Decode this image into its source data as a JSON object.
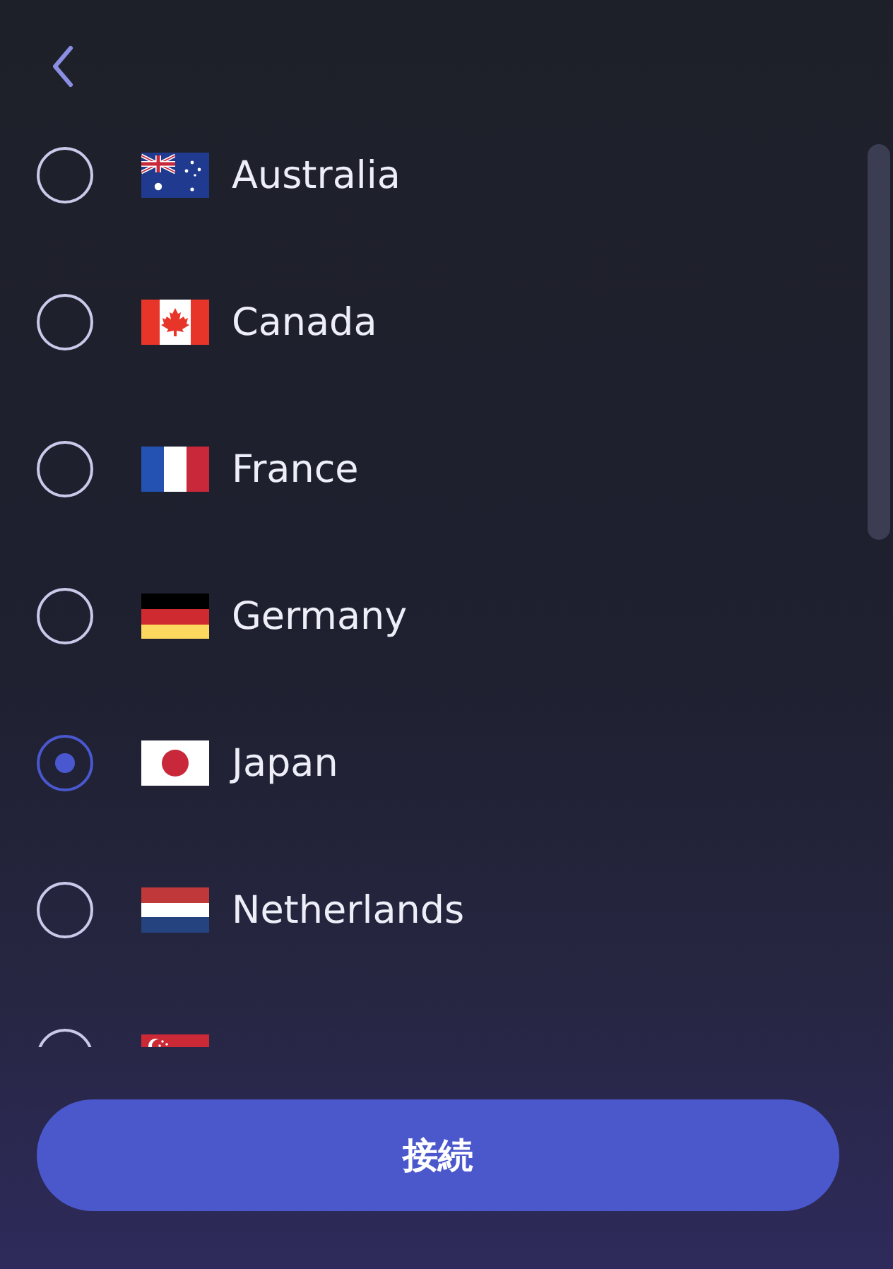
{
  "countries": [
    {
      "name": "Australia",
      "kind": "au",
      "selected": false
    },
    {
      "name": "Canada",
      "kind": "ca",
      "selected": false
    },
    {
      "name": "France",
      "kind": "fr",
      "selected": false
    },
    {
      "name": "Germany",
      "kind": "de",
      "selected": false
    },
    {
      "name": "Japan",
      "kind": "jp",
      "selected": true
    },
    {
      "name": "Netherlands",
      "kind": "nl",
      "selected": false
    },
    {
      "kind": "sg",
      "selected": false
    }
  ],
  "connect_button": {
    "label": "接続"
  }
}
